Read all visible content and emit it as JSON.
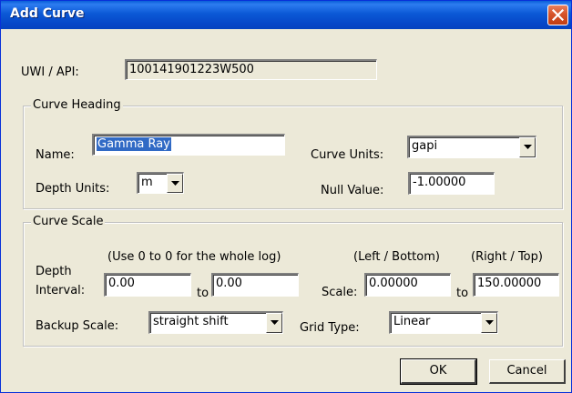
{
  "window": {
    "title": "Add Curve"
  },
  "uwi": {
    "label": "UWI / API:",
    "value": "100141901223W500"
  },
  "curve_heading": {
    "title": "Curve Heading",
    "name_label": "Name:",
    "name_value": "Gamma Ray",
    "curve_units_label": "Curve Units:",
    "curve_units_value": "gapi",
    "depth_units_label": "Depth Units:",
    "depth_units_value": "m",
    "null_value_label": "Null Value:",
    "null_value": "-1.00000"
  },
  "curve_scale": {
    "title": "Curve Scale",
    "depth_hint": "(Use 0 to 0 for the whole log)",
    "left_hint": "(Left / Bottom)",
    "right_hint": "(Right / Top)",
    "depth_label_line1": "Depth",
    "depth_label_line2": "Interval:",
    "depth_from": "0.00",
    "to_label_1": "to",
    "depth_to": "0.00",
    "scale_label": "Scale:",
    "scale_left": "0.00000",
    "to_label_2": "to",
    "scale_right": "150.00000",
    "backup_label": "Backup Scale:",
    "backup_value": "straight shift",
    "grid_label": "Grid Type:",
    "grid_value": "Linear"
  },
  "buttons": {
    "ok": "OK",
    "cancel": "Cancel"
  },
  "colors": {
    "title_bar": "#0a5fd8",
    "selection": "#316ac5",
    "dialog_bg": "#ece9d8"
  },
  "icons": {
    "close": "close-icon",
    "dropdown": "chevron-down-icon"
  }
}
